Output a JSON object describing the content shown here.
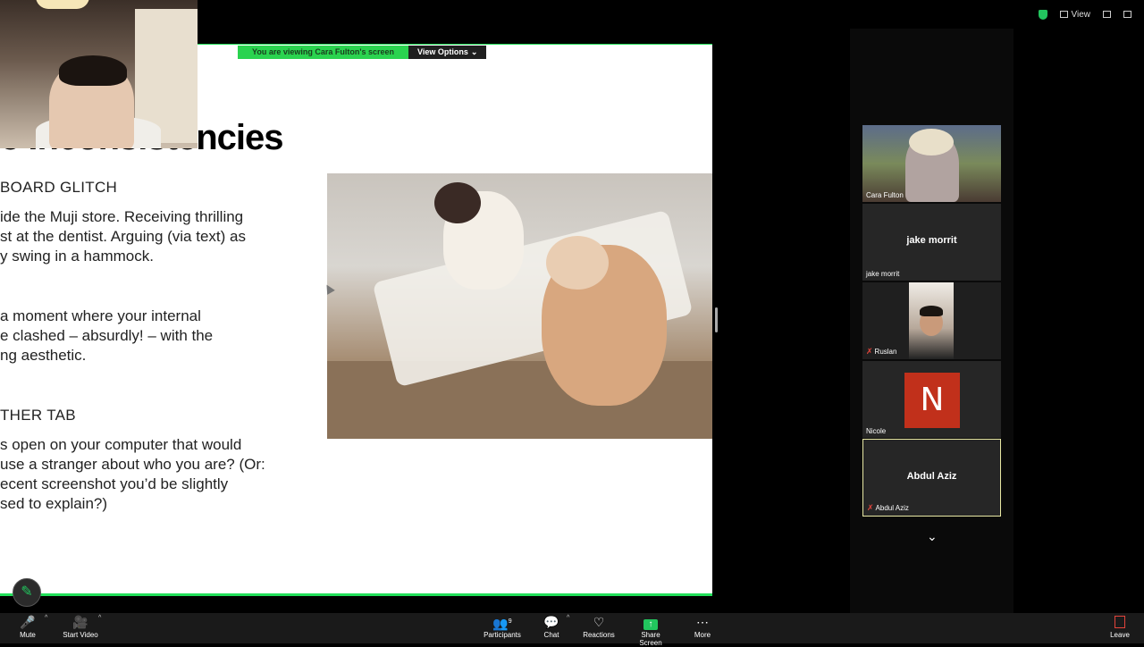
{
  "header": {
    "view_label": "View"
  },
  "banner": {
    "viewing_text": "You are viewing  Cara Fulton's screen",
    "view_options": "View Options"
  },
  "slide": {
    "title": "e Inconsistencies",
    "heading1": "BOARD GLITCH",
    "para1": [
      "ide the Muji store. Receiving thrilling",
      "st at the dentist. Arguing (via text) as",
      "y swing in a hammock."
    ],
    "para2": [
      "a moment where your internal",
      "e clashed – absurdly! – with the",
      "ng aesthetic."
    ],
    "heading2": "THER TAB",
    "para3": [
      "s open on your computer that would",
      "use a stranger about who you are? (Or:",
      "ecent screenshot you’d be slightly",
      "sed to explain?)"
    ]
  },
  "participants": [
    {
      "name": "Cara Fulton"
    },
    {
      "name": "jake morrit",
      "center": "jake morrit"
    },
    {
      "name": "Ruslan"
    },
    {
      "name": "Nicole",
      "initial": "N"
    },
    {
      "name": "Abdul Aziz",
      "center": "Abdul Aziz"
    }
  ],
  "toolbar": {
    "mute": "Mute",
    "start_video": "Start Video",
    "participants": "Participants",
    "participants_count": "9",
    "chat": "Chat",
    "reactions": "Reactions",
    "share_screen": "Share Screen",
    "more": "More",
    "leave": "Leave"
  },
  "colors": {
    "accent_green": "#22e05a",
    "nicole_avatar": "#c1301b",
    "muted_red": "#e2443b"
  }
}
